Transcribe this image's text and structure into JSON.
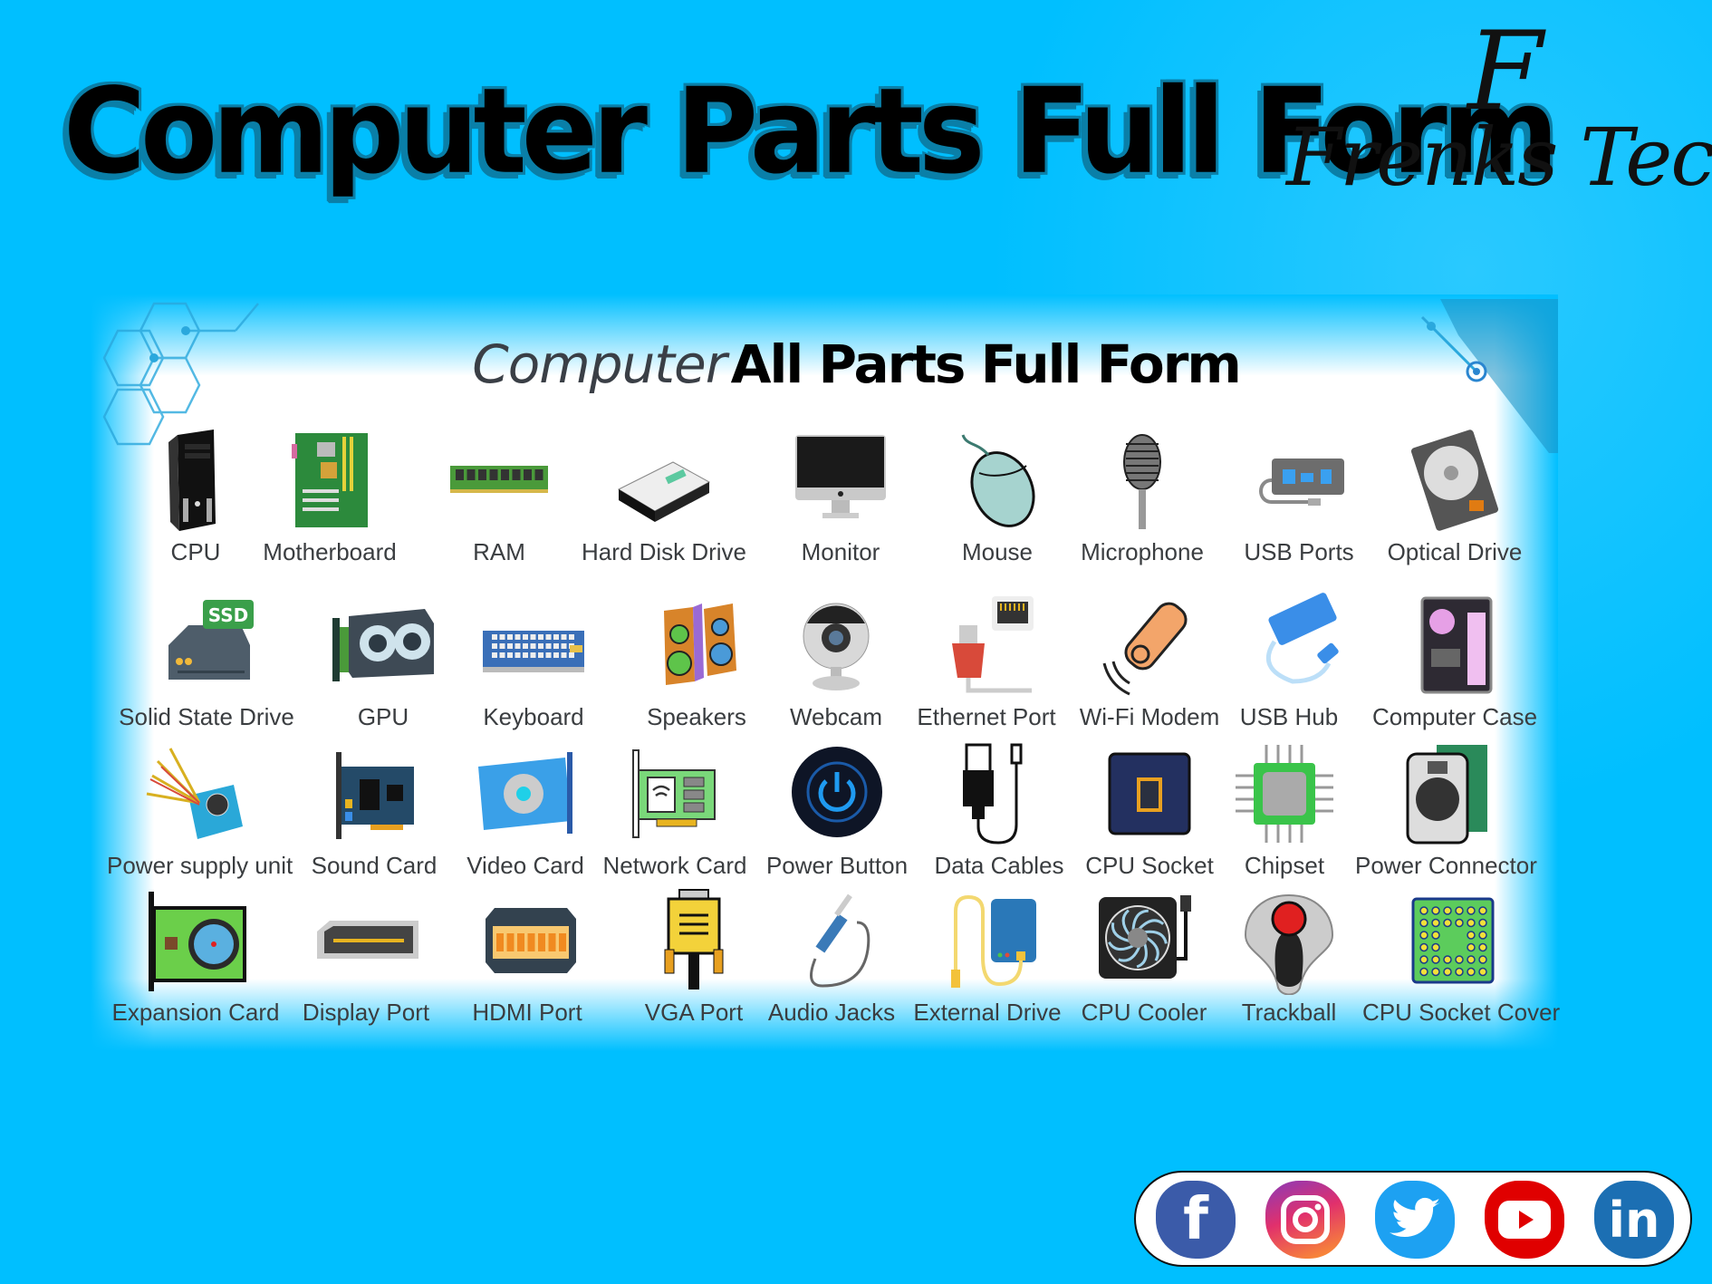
{
  "header": {
    "title": "Computer Parts Full Form",
    "logo_monogram": "F",
    "logo_text": "Frenks Tech"
  },
  "card": {
    "subtitle_light": "Computer",
    "subtitle_bold": "All Parts Full Form",
    "rows": [
      [
        {
          "label": "CPU",
          "icon": "cpu-tower-icon"
        },
        {
          "label": "Motherboard",
          "icon": "motherboard-icon"
        },
        {
          "label": "RAM",
          "icon": "ram-icon"
        },
        {
          "label": "Hard Disk Drive",
          "icon": "hard-disk-icon"
        },
        {
          "label": "Monitor",
          "icon": "monitor-icon"
        },
        {
          "label": "Mouse",
          "icon": "mouse-icon"
        },
        {
          "label": "Microphone",
          "icon": "microphone-icon"
        },
        {
          "label": "USB Ports",
          "icon": "usb-ports-icon"
        },
        {
          "label": "Optical Drive",
          "icon": "optical-drive-icon"
        }
      ],
      [
        {
          "label": "Solid State Drive",
          "icon": "ssd-icon",
          "badge": "SSD"
        },
        {
          "label": "GPU",
          "icon": "gpu-icon"
        },
        {
          "label": "Keyboard",
          "icon": "keyboard-icon"
        },
        {
          "label": "Speakers",
          "icon": "speakers-icon"
        },
        {
          "label": "Webcam",
          "icon": "webcam-icon"
        },
        {
          "label": "Ethernet Port",
          "icon": "ethernet-port-icon"
        },
        {
          "label": "Wi-Fi Modem",
          "icon": "wifi-modem-icon"
        },
        {
          "label": "USB Hub",
          "icon": "usb-hub-icon"
        },
        {
          "label": "Computer Case",
          "icon": "computer-case-icon"
        }
      ],
      [
        {
          "label": "Power supply unit",
          "icon": "power-supply-icon"
        },
        {
          "label": "Sound Card",
          "icon": "sound-card-icon"
        },
        {
          "label": "Video Card",
          "icon": "video-card-icon"
        },
        {
          "label": "Network Card",
          "icon": "network-card-icon"
        },
        {
          "label": "Power Button",
          "icon": "power-button-icon"
        },
        {
          "label": "Data Cables",
          "icon": "data-cables-icon"
        },
        {
          "label": "CPU Socket",
          "icon": "cpu-socket-icon"
        },
        {
          "label": "Chipset",
          "icon": "chipset-icon"
        },
        {
          "label": "Power Connector",
          "icon": "power-connector-icon"
        }
      ],
      [
        {
          "label": "Expansion Card",
          "icon": "expansion-card-icon"
        },
        {
          "label": "Display Port",
          "icon": "display-port-icon"
        },
        {
          "label": "HDMI Port",
          "icon": "hdmi-port-icon"
        },
        {
          "label": "VGA Port",
          "icon": "vga-port-icon"
        },
        {
          "label": "Audio Jacks",
          "icon": "audio-jack-icon"
        },
        {
          "label": "External Drive",
          "icon": "external-drive-icon"
        },
        {
          "label": "CPU Cooler",
          "icon": "cpu-cooler-icon"
        },
        {
          "label": "Trackball",
          "icon": "trackball-icon"
        },
        {
          "label": "CPU Socket Cover",
          "icon": "cpu-socket-cover-icon"
        }
      ]
    ]
  },
  "social": [
    {
      "name": "facebook",
      "glyph": "f",
      "color": "#3b5ba9"
    },
    {
      "name": "instagram",
      "glyph": "◎",
      "color": "#e1306c"
    },
    {
      "name": "twitter",
      "glyph": "🐦",
      "color": "#1da1f2"
    },
    {
      "name": "youtube",
      "glyph": "▶",
      "color": "#e00000"
    },
    {
      "name": "linkedin",
      "glyph": "in",
      "color": "#1c6fb3"
    }
  ],
  "colors": {
    "background": "#00bfff",
    "card": "#ffffff",
    "label_text": "#3a3d40"
  }
}
